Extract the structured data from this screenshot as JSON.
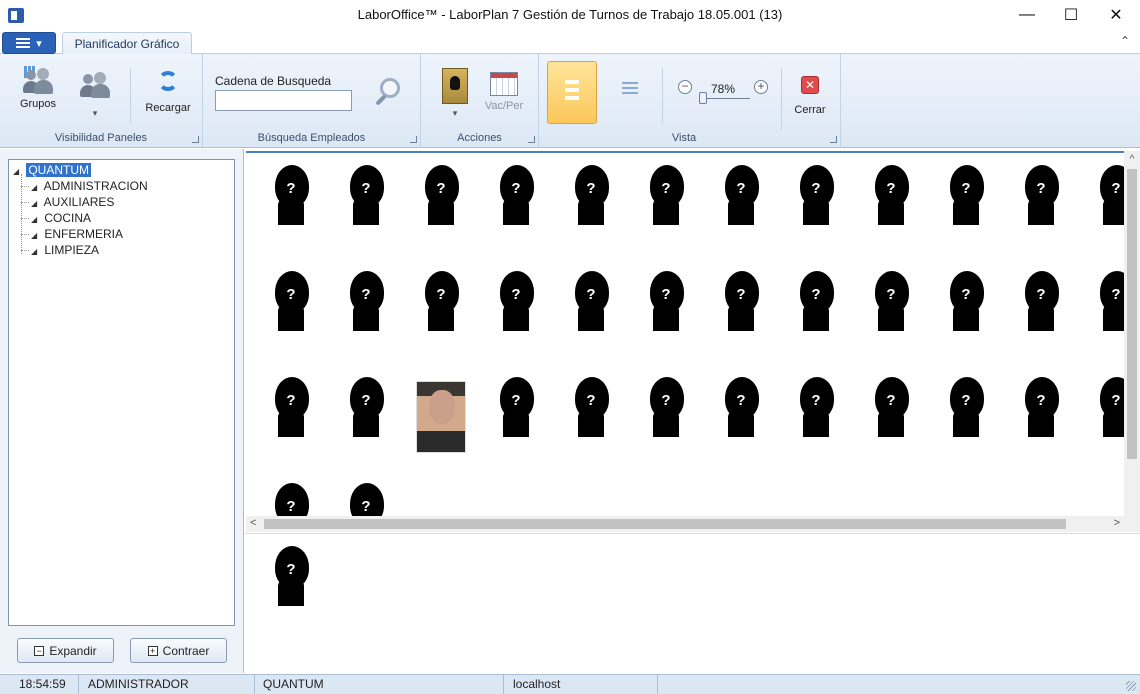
{
  "window": {
    "title": "LaborOffice™ - LaborPlan 7 Gestión de Turnos de Trabajo 18.05.001 (13)",
    "minimize": "—",
    "maximize": "☐",
    "close": "✕"
  },
  "ribbon": {
    "app_menu_caret": "▾",
    "tab_active": "Planificador Gráfico",
    "collapse_glyph": "⌃",
    "groups": {
      "visibilidad": {
        "label": "Visibilidad Paneles",
        "grupos": "Grupos",
        "caret": "▾"
      },
      "recargar": {
        "label": "Recargar"
      },
      "busqueda": {
        "label": "Búsqueda Empleados",
        "search_label": "Cadena de Busqueda",
        "search_value": "",
        "search_placeholder": ""
      },
      "acciones": {
        "label": "Acciones",
        "vacper": "Vac/Per",
        "caret": "▾"
      },
      "vista": {
        "label": "Vista",
        "zoom": "78%",
        "zoom_minus": "−",
        "zoom_plus": "+",
        "zoom_fraction": 0.1
      },
      "cerrar": {
        "label": "Cerrar",
        "glyph": "✕"
      }
    }
  },
  "tree": {
    "root": "QUANTUM",
    "expanded_glyph": "◢",
    "children": [
      "ADMINISTRACION",
      "AUXILIARES",
      "COCINA",
      "ENFERMERIA",
      "LIMPIEZA"
    ]
  },
  "panel_buttons": {
    "expand": "Expandir",
    "expand_glyph": "−",
    "collapse": "Contraer",
    "collapse_glyph": "+"
  },
  "employees_placeholder_glyph": "?",
  "scroll": {
    "up": "^",
    "left": "<",
    "right": ">"
  },
  "status": {
    "time": "18:54:59",
    "user": "ADMINISTRADOR",
    "company": "QUANTUM",
    "server": "localhost"
  },
  "colors": {
    "accent": "#3173c9",
    "ribbon_bg": "#dde8f5",
    "active_view": "#fbc75a",
    "close_red": "#e24b4b"
  },
  "icons": {
    "grupos": "people-grid-icon",
    "people": "people-icon",
    "recargar": "refresh-icon",
    "search": "magnifier-icon",
    "acciones": "badge-icon",
    "vacper": "calendar-icon",
    "vista_icons": "icon-view-icon",
    "vista_list": "list-view-icon",
    "cerrar": "close-icon"
  }
}
